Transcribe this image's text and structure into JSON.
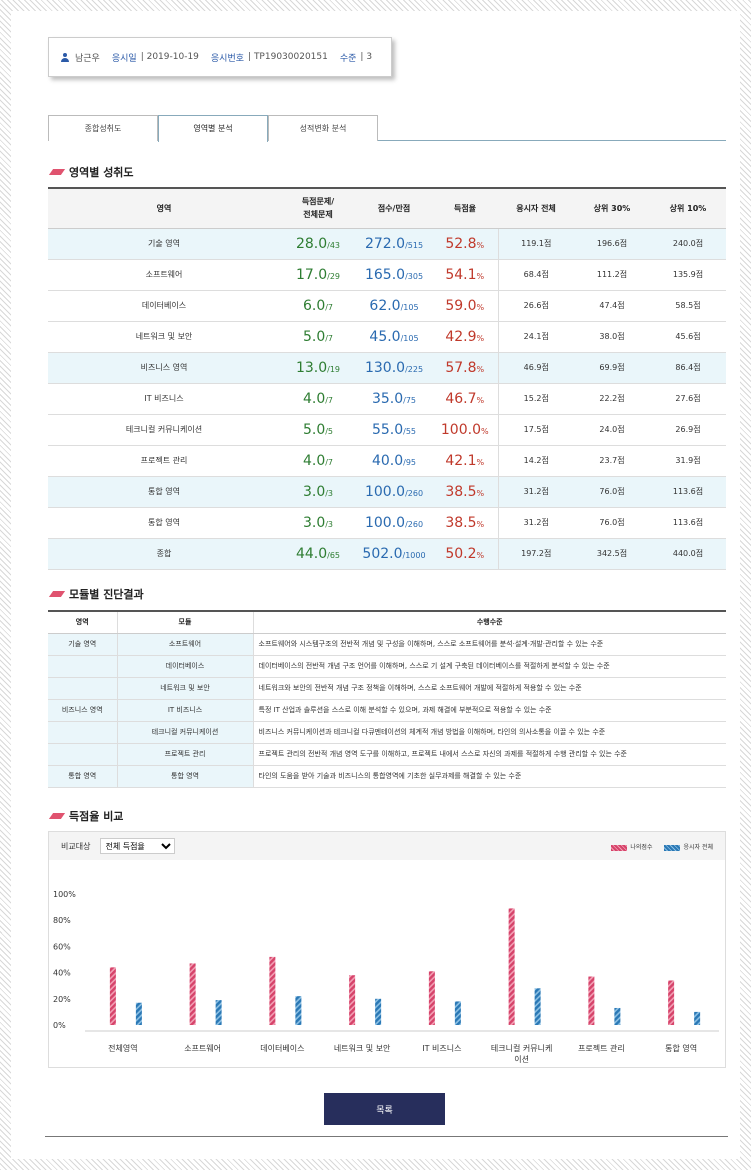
{
  "profile": {
    "name": "남근우",
    "exam_date_label": "응시일",
    "exam_date": "2019-10-19",
    "exam_no_label": "응시번호",
    "exam_no": "TP19030020151",
    "level_label": "수준",
    "level": "3"
  },
  "tabs": [
    "종합성취도",
    "영역별 분석",
    "성적변화 분석"
  ],
  "section1": {
    "title": "영역별 성취도"
  },
  "score_table": {
    "headers": [
      "영역",
      "득점문제/\n전체문제",
      "점수/만점",
      "득점율",
      "응시자 전체",
      "상위 30%",
      "상위 10%"
    ],
    "rows": [
      {
        "area": "기술 영역",
        "got": "28.0",
        "tot": "/43",
        "score": "272.0",
        "max": "/515",
        "rate": "52.8",
        "pct": "%",
        "all": "119.1점",
        "top30": "196.6점",
        "top10": "240.0점",
        "hl": true
      },
      {
        "area": "소프트웨어",
        "got": "17.0",
        "tot": "/29",
        "score": "165.0",
        "max": "/305",
        "rate": "54.1",
        "pct": "%",
        "all": "68.4점",
        "top30": "111.2점",
        "top10": "135.9점",
        "hl": false
      },
      {
        "area": "데이터베이스",
        "got": "6.0",
        "tot": "/7",
        "score": "62.0",
        "max": "/105",
        "rate": "59.0",
        "pct": "%",
        "all": "26.6점",
        "top30": "47.4점",
        "top10": "58.5점",
        "hl": false
      },
      {
        "area": "네트워크 및 보안",
        "got": "5.0",
        "tot": "/7",
        "score": "45.0",
        "max": "/105",
        "rate": "42.9",
        "pct": "%",
        "all": "24.1점",
        "top30": "38.0점",
        "top10": "45.6점",
        "hl": false
      },
      {
        "area": "비즈니스 영역",
        "got": "13.0",
        "tot": "/19",
        "score": "130.0",
        "max": "/225",
        "rate": "57.8",
        "pct": "%",
        "all": "46.9점",
        "top30": "69.9점",
        "top10": "86.4점",
        "hl": true
      },
      {
        "area": "IT 비즈니스",
        "got": "4.0",
        "tot": "/7",
        "score": "35.0",
        "max": "/75",
        "rate": "46.7",
        "pct": "%",
        "all": "15.2점",
        "top30": "22.2점",
        "top10": "27.6점",
        "hl": false
      },
      {
        "area": "테크니컬 커뮤니케이션",
        "got": "5.0",
        "tot": "/5",
        "score": "55.0",
        "max": "/55",
        "rate": "100.0",
        "pct": "%",
        "all": "17.5점",
        "top30": "24.0점",
        "top10": "26.9점",
        "hl": false
      },
      {
        "area": "프로젝트 관리",
        "got": "4.0",
        "tot": "/7",
        "score": "40.0",
        "max": "/95",
        "rate": "42.1",
        "pct": "%",
        "all": "14.2점",
        "top30": "23.7점",
        "top10": "31.9점",
        "hl": false
      },
      {
        "area": "통합 영역",
        "got": "3.0",
        "tot": "/3",
        "score": "100.0",
        "max": "/260",
        "rate": "38.5",
        "pct": "%",
        "all": "31.2점",
        "top30": "76.0점",
        "top10": "113.6점",
        "hl": true
      },
      {
        "area": "통합 영역",
        "got": "3.0",
        "tot": "/3",
        "score": "100.0",
        "max": "/260",
        "rate": "38.5",
        "pct": "%",
        "all": "31.2점",
        "top30": "76.0점",
        "top10": "113.6점",
        "hl": false
      },
      {
        "area": "종합",
        "got": "44.0",
        "tot": "/65",
        "score": "502.0",
        "max": "/1000",
        "rate": "50.2",
        "pct": "%",
        "all": "197.2점",
        "top30": "342.5점",
        "top10": "440.0점",
        "hl": true
      }
    ]
  },
  "section2": {
    "title": "모듈별 진단결과"
  },
  "module_table": {
    "headers": [
      "영역",
      "모듈",
      "수행수준"
    ],
    "rows": [
      {
        "area": "기술 영역",
        "module": "소프트웨어",
        "desc": "소프트웨어와 시스템구조의 전반적 개념 및 구성을 이해하며, 스스로 소프트웨어를 분석·설계·개발·관리할 수 있는 수준"
      },
      {
        "area": "",
        "module": "데이터베이스",
        "desc": "데이터베이스의 전반적 개념 구조 언어를 이해하며, 스스로 기 설계 구축된 데이터베이스를 적절하게 분석할 수 있는 수준"
      },
      {
        "area": "",
        "module": "네트워크 및 보안",
        "desc": "네트워크와 보안의 전반적 개념 구조 정책을 이해하며, 스스로 소프트웨어 개발에 적절하게 적용할 수 있는 수준"
      },
      {
        "area": "비즈니스 영역",
        "module": "IT 비즈니스",
        "desc": "특정 IT 산업과 솔루션을 스스로 이해 분석할 수 있으며, 과제 해결에 부분적으로 적용할 수 있는 수준"
      },
      {
        "area": "",
        "module": "테크니컬 커뮤니케이션",
        "desc": "비즈니스 커뮤니케이션과 테크니컬 다큐멘테이션의 체계적 개념 방법을 이해하며, 타인의 의사소통을 이끌 수 있는 수준"
      },
      {
        "area": "",
        "module": "프로젝트 관리",
        "desc": "프로젝트 관리의 전반적 개념 영역 도구를 이해하고, 프로젝트 내에서 스스로 자신의 과제를 적절하게 수행 관리할 수 있는 수준"
      },
      {
        "area": "통합 영역",
        "module": "통합 영역",
        "desc": "타인의 도움을 받아 기술과 비즈니스의 통합영역에 기초한 실무과제를 해결할 수 있는 수준"
      }
    ]
  },
  "section3": {
    "title": "득점율 비교"
  },
  "chart_controls": {
    "compare_label": "비교대상",
    "select_value": "전체 득점율",
    "legend_mine": "나의점수",
    "legend_all": "응시자 전체",
    "color_mine": "#d6436a",
    "color_all": "#2a78b5"
  },
  "chart_data": {
    "type": "bar",
    "categories": [
      "전체영역",
      "소프트웨어",
      "데이터베이스",
      "네트워크 및 보안",
      "IT 비즈니스",
      "테크니컬 커뮤니케\n이션",
      "프로젝트 관리",
      "통합 영역"
    ],
    "series": [
      {
        "name": "나의점수",
        "values": [
          44,
          47,
          52,
          38,
          41,
          89,
          37,
          34
        ]
      },
      {
        "name": "응시자 전체",
        "values": [
          17,
          19,
          22,
          20,
          18,
          28,
          13,
          10
        ]
      }
    ],
    "yticks": [
      "100%",
      "80%",
      "60%",
      "40%",
      "20%",
      "0%"
    ],
    "ylim": [
      0,
      100
    ],
    "grid": false,
    "legend": "top-right"
  },
  "list_button": "목록"
}
